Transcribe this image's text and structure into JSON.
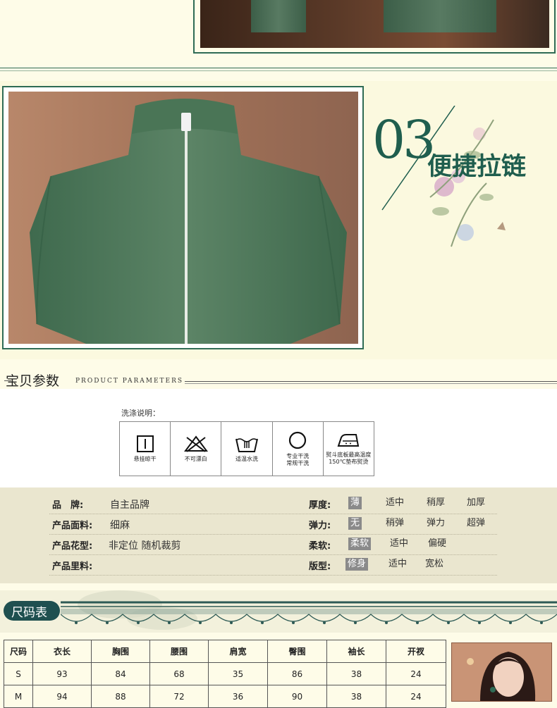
{
  "feature": {
    "number": "03",
    "title": "便捷拉链"
  },
  "parameters": {
    "title": "宝贝参数",
    "subtitle": "PRODUCT PARAMETERS"
  },
  "wash": {
    "title": "洗涤说明：",
    "items": [
      {
        "icon": "hang-dry-icon",
        "label": "悬挂晾干"
      },
      {
        "icon": "no-bleach-icon",
        "label": "不可漂白"
      },
      {
        "icon": "warm-wash-icon",
        "label": "适温水洗"
      },
      {
        "icon": "dry-clean-icon",
        "label": "专业干洗\n常规干洗"
      },
      {
        "icon": "iron-icon",
        "label": "熨斗底板最高温度\n150℃垫布熨烫"
      }
    ]
  },
  "specs": {
    "rows": [
      {
        "key": "品　牌:",
        "value": "自主品牌",
        "key2": "厚度:",
        "options": [
          "薄",
          "适中",
          "稍厚",
          "加厚"
        ],
        "selected": 0
      },
      {
        "key": "产品面料:",
        "value": "细麻",
        "key2": "弹力:",
        "options": [
          "无",
          "稍弹",
          "弹力",
          "超弹"
        ],
        "selected": 0
      },
      {
        "key": "产品花型:",
        "value": "非定位  随机裁剪",
        "key2": "柔软:",
        "options": [
          "柔软",
          "适中",
          "偏硬"
        ],
        "selected": 0
      },
      {
        "key": "产品里料:",
        "value": "",
        "key2": "版型:",
        "options": [
          "修身",
          "适中",
          "宽松"
        ],
        "selected": 0
      }
    ]
  },
  "size_chart": {
    "title": "尺码表",
    "headers": [
      "尺码",
      "衣长",
      "胸围",
      "腰围",
      "肩宽",
      "臀围",
      "袖长",
      "开衩"
    ],
    "rows": [
      [
        "S",
        "93",
        "84",
        "68",
        "35",
        "86",
        "38",
        "24"
      ],
      [
        "M",
        "94",
        "88",
        "72",
        "36",
        "90",
        "38",
        "24"
      ]
    ]
  },
  "colors": {
    "accent": "#1f5e4e",
    "band": "#eae6cf",
    "background": "#fefce8",
    "selected": "#8a8a8a"
  }
}
